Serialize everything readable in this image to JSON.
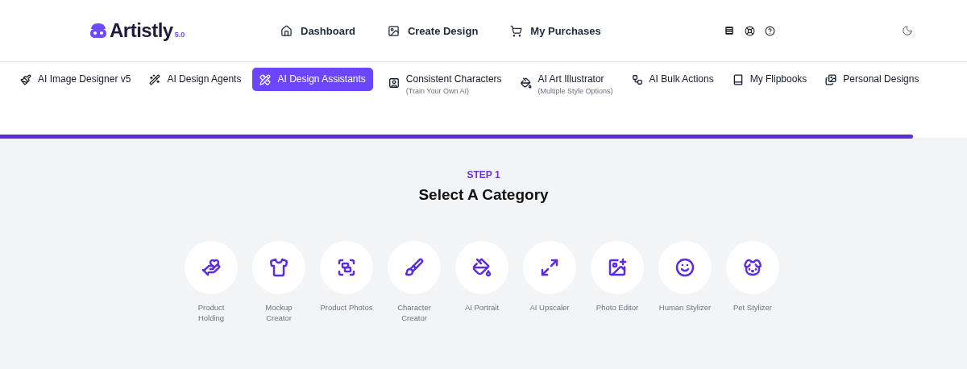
{
  "logo": {
    "name": "Artistly",
    "version": "5.0"
  },
  "nav": [
    {
      "label": "Dashboard"
    },
    {
      "label": "Create Design"
    },
    {
      "label": "My Purchases"
    }
  ],
  "tabs": [
    {
      "label": "AI Image Designer v5",
      "selected": false
    },
    {
      "label": "AI Design Agents",
      "selected": false
    },
    {
      "label": "AI Design Assistants",
      "selected": true
    },
    {
      "label": "Consistent Characters",
      "sublabel": "(Train Your Own AI)",
      "selected": false
    },
    {
      "label": "AI Art Illustrator",
      "sublabel": "(Multiple Style Options)",
      "selected": false
    },
    {
      "label": "AI Bulk Actions",
      "selected": false
    },
    {
      "label": "My Flipbooks",
      "selected": false
    },
    {
      "label": "Personal Designs",
      "selected": false
    }
  ],
  "progress": {
    "level": 0.944
  },
  "step": {
    "label": "STEP 1",
    "title": "Select A Category"
  },
  "categories": [
    {
      "label": "Product\nHolding"
    },
    {
      "label": "Mockup\nCreator"
    },
    {
      "label": "Product Photos"
    },
    {
      "label": "Character\nCreator"
    },
    {
      "label": "AI Portrait"
    },
    {
      "label": "AI Upscaler"
    },
    {
      "label": "Photo Editor"
    },
    {
      "label": "Human Stylizer"
    },
    {
      "label": "Pet Stylizer"
    }
  ]
}
